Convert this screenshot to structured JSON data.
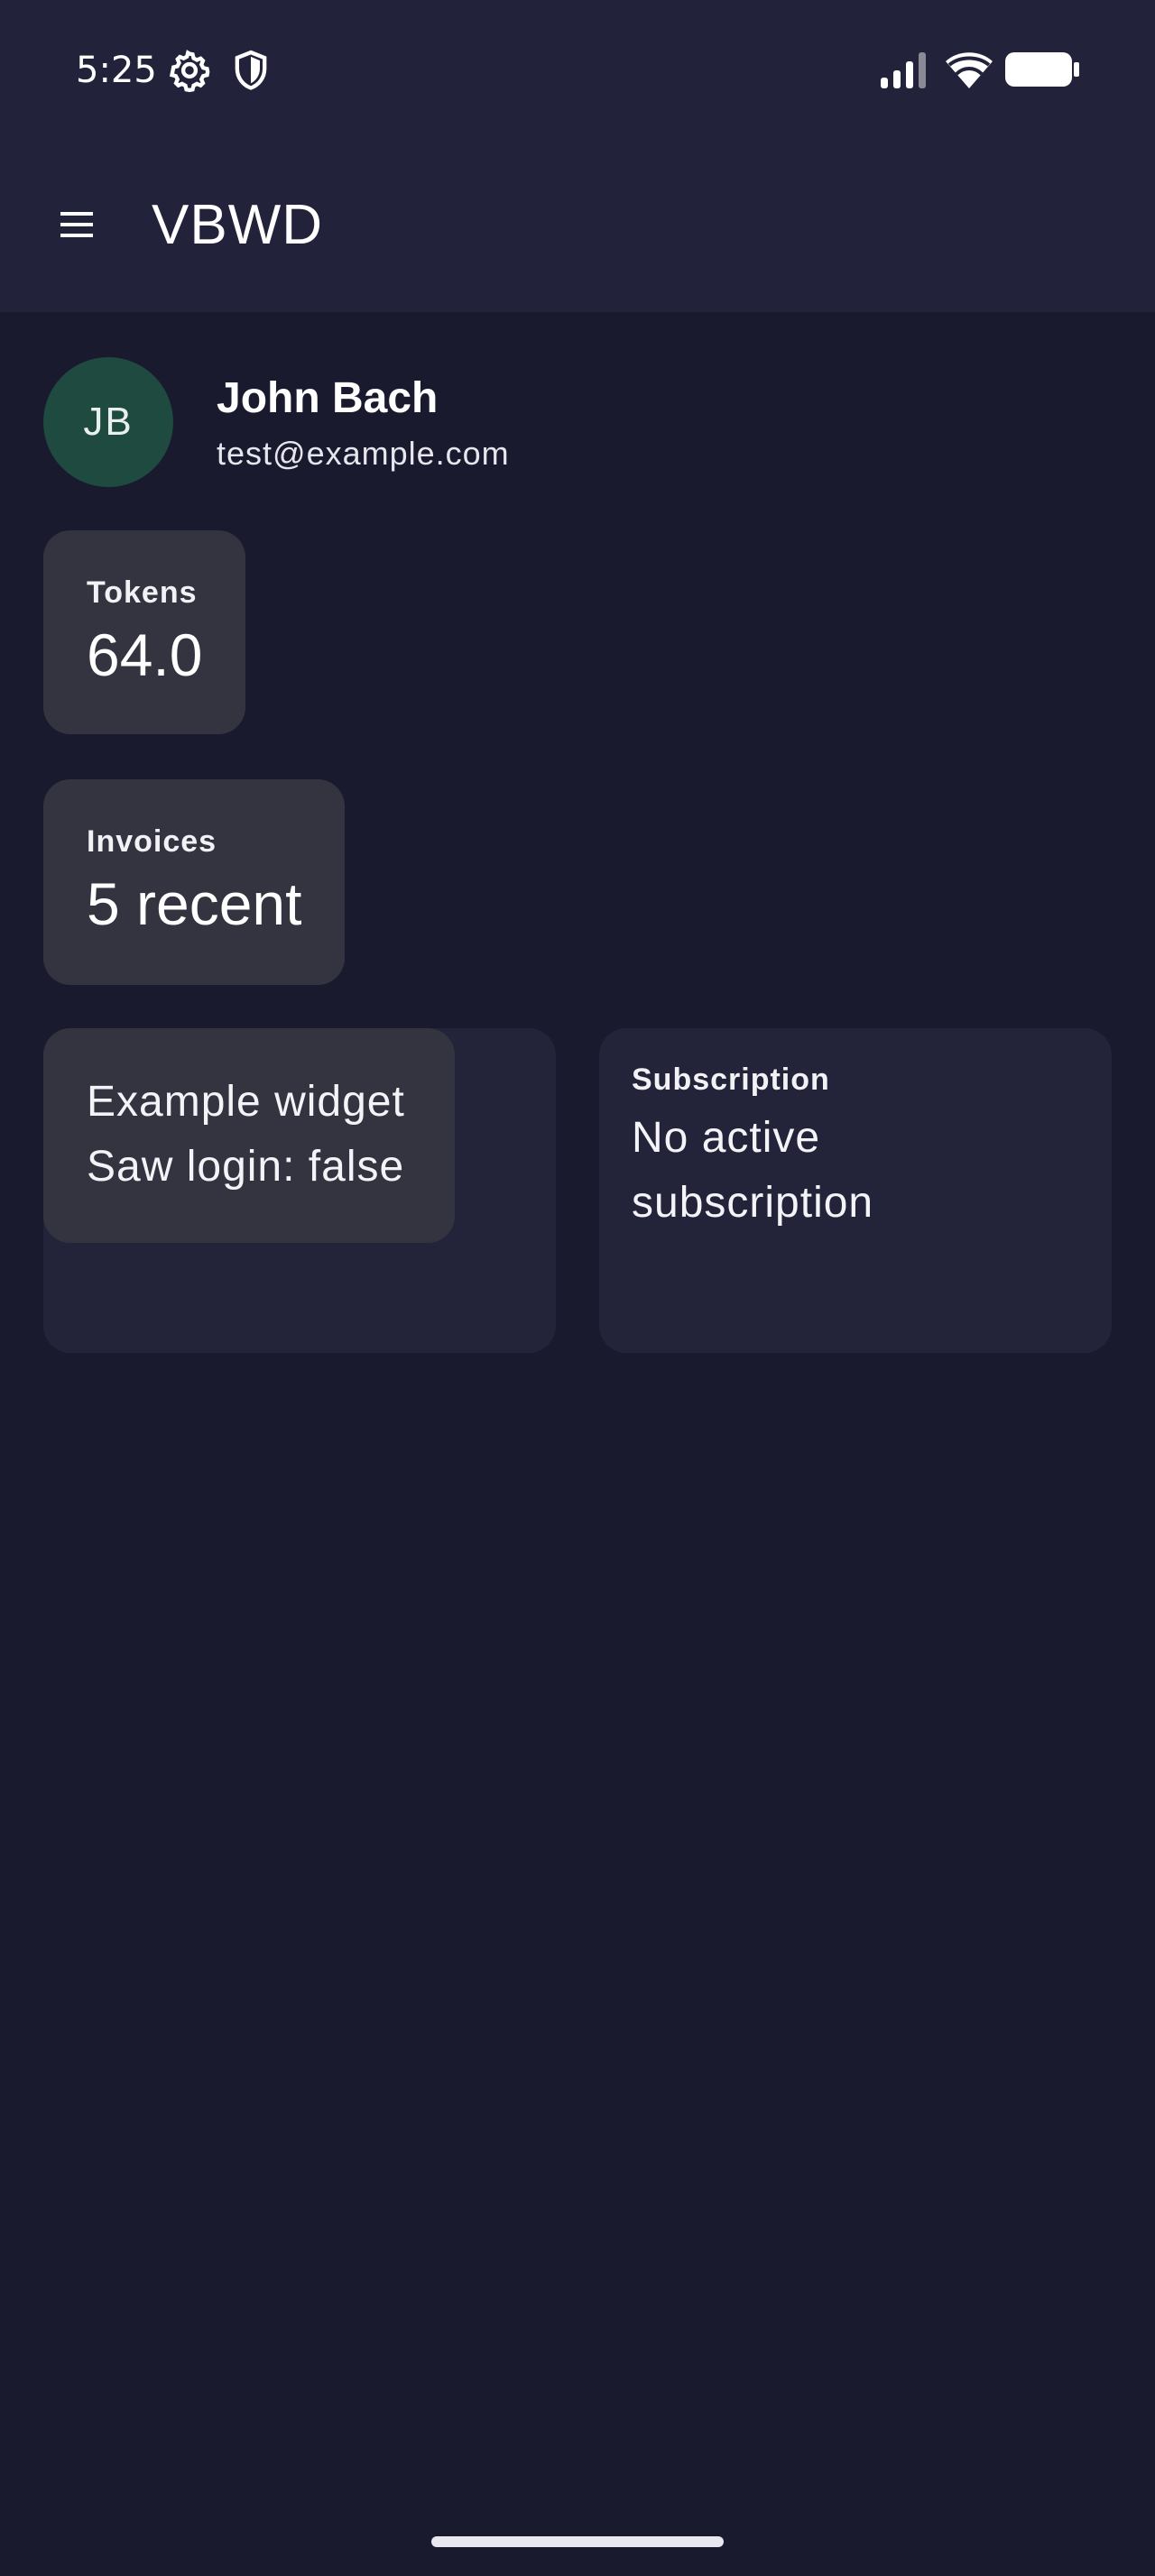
{
  "status_bar": {
    "time": "5:25",
    "icons": [
      "gear-icon",
      "shield-icon",
      "signal-icon",
      "wifi-icon",
      "battery-icon"
    ]
  },
  "app_bar": {
    "title": "VBWD",
    "menu_icon": "menu-icon"
  },
  "profile": {
    "initials": "JB",
    "name": "John Bach",
    "email": "test@example.com"
  },
  "stats": {
    "tokens": {
      "label": "Tokens",
      "value": "64.0"
    },
    "invoices": {
      "label": "Invoices",
      "value": "5 recent"
    }
  },
  "widgets": {
    "example": {
      "line1": "Example widget",
      "line2": "Saw login: false"
    },
    "subscription": {
      "label": "Subscription",
      "value": "No active subscription"
    }
  },
  "colors": {
    "background": "#1a1a2e",
    "app_bar": "#22233a",
    "card": "#343440",
    "widget_card": "#23243a",
    "avatar": "#1f4a40"
  }
}
